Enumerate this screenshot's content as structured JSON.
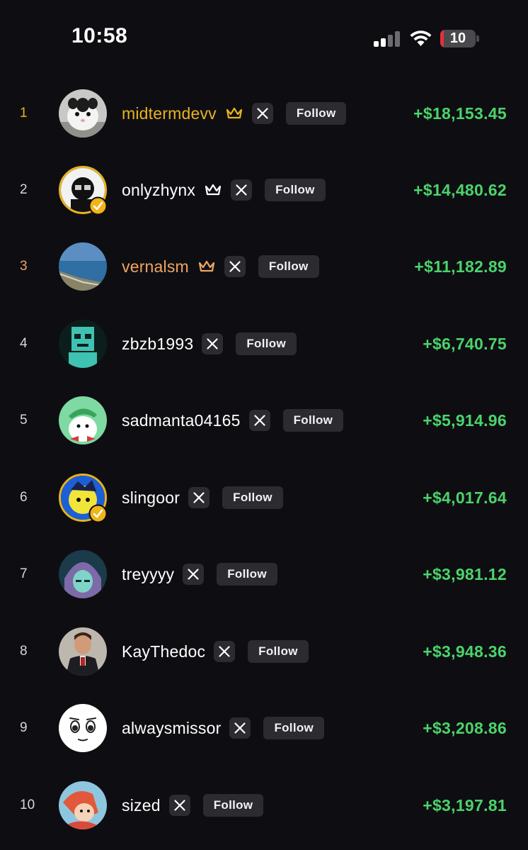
{
  "status_bar": {
    "time": "10:58",
    "battery_level": "10",
    "battery_fraction": 0.1,
    "icons": [
      "signal-icon",
      "wifi-icon",
      "battery-icon"
    ]
  },
  "colors": {
    "gold": "#e8b320",
    "bronze": "#f0a561",
    "profit_green": "#4bd36b",
    "button_bg": "#2b2b30"
  },
  "leaderboard": [
    {
      "rank": "1",
      "username": "midtermdevv",
      "crown": true,
      "follow_label": "Follow",
      "profit": "+$18,153.45"
    },
    {
      "rank": "2",
      "username": "onlyzhynx",
      "crown": true,
      "follow_label": "Follow",
      "profit": "+$14,480.62"
    },
    {
      "rank": "3",
      "username": "vernalsm",
      "crown": true,
      "follow_label": "Follow",
      "profit": "+$11,182.89"
    },
    {
      "rank": "4",
      "username": "zbzb1993",
      "crown": false,
      "follow_label": "Follow",
      "profit": "+$6,740.75"
    },
    {
      "rank": "5",
      "username": "sadmanta04165",
      "crown": false,
      "follow_label": "Follow",
      "profit": "+$5,914.96"
    },
    {
      "rank": "6",
      "username": "slingoor",
      "crown": false,
      "follow_label": "Follow",
      "profit": "+$4,017.64"
    },
    {
      "rank": "7",
      "username": "treyyyy",
      "crown": false,
      "follow_label": "Follow",
      "profit": "+$3,981.12"
    },
    {
      "rank": "8",
      "username": "KayThedoc",
      "crown": false,
      "follow_label": "Follow",
      "profit": "+$3,948.36"
    },
    {
      "rank": "9",
      "username": "alwaysmissor",
      "crown": false,
      "follow_label": "Follow",
      "profit": "+$3,208.86"
    },
    {
      "rank": "10",
      "username": "sized",
      "crown": false,
      "follow_label": "Follow",
      "profit": "+$3,197.81"
    }
  ]
}
